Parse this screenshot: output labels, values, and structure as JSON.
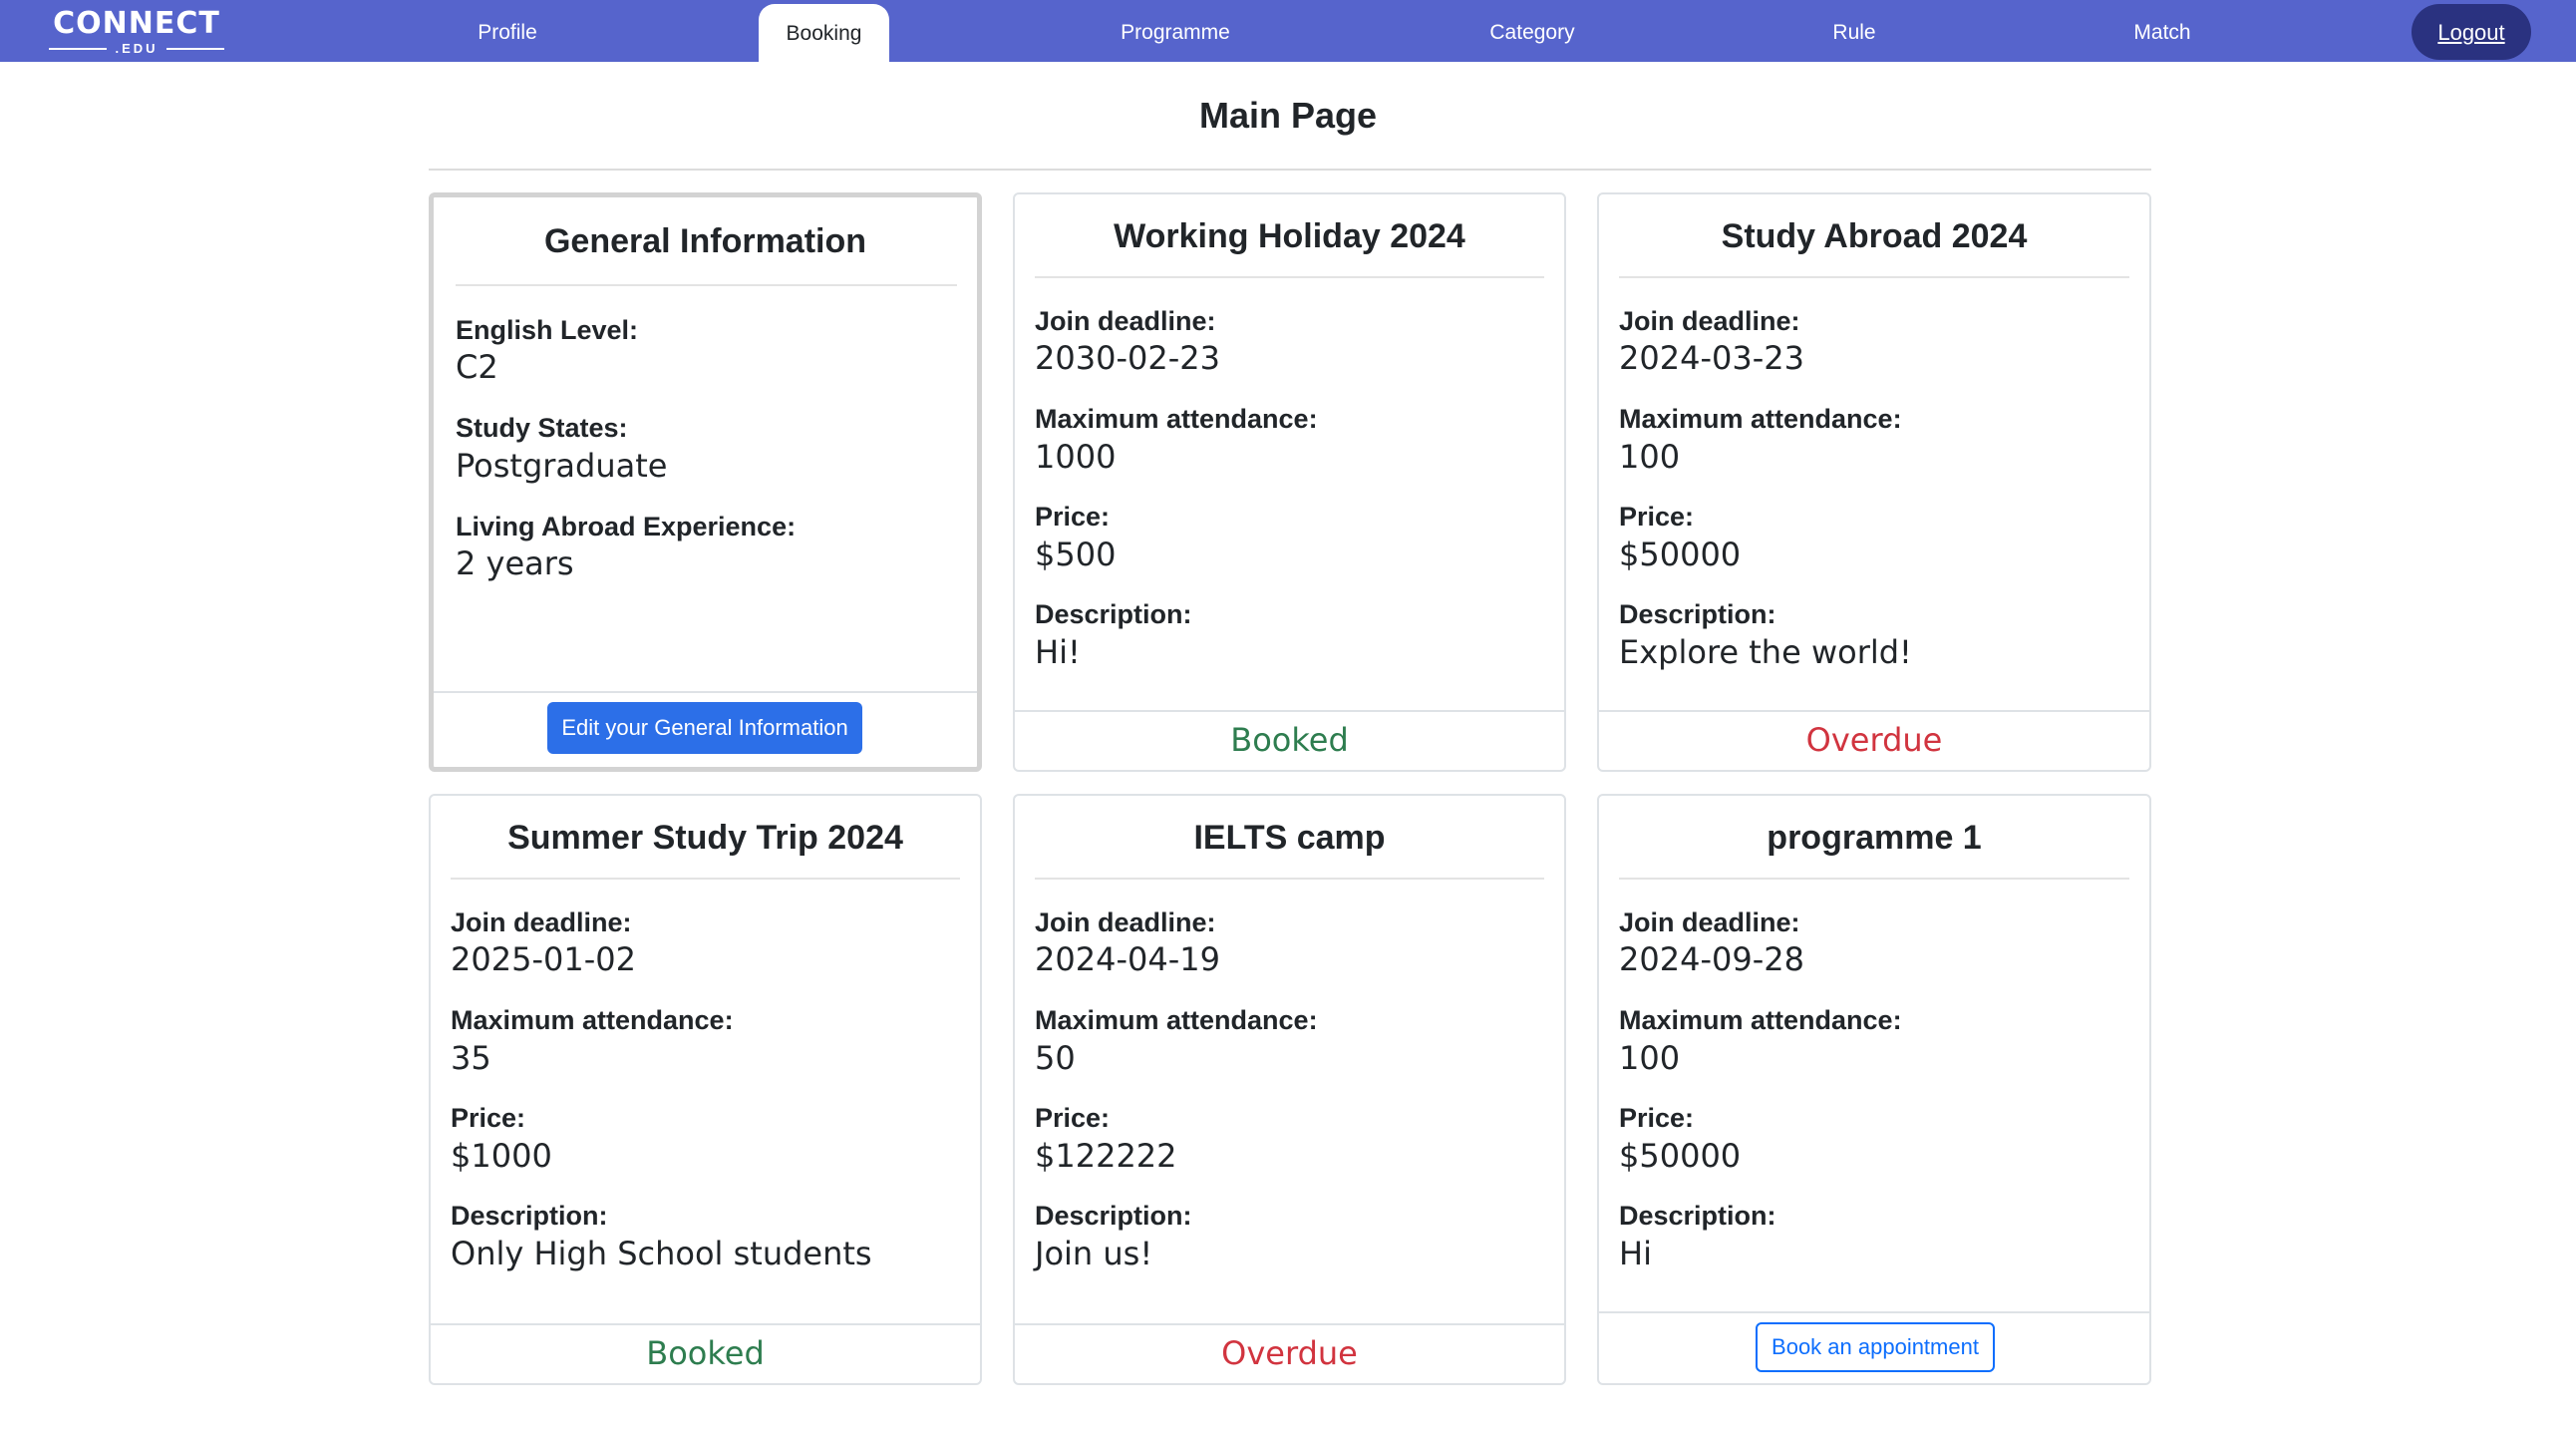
{
  "nav": {
    "logo_main": "CONNECT",
    "logo_sub": ".EDU",
    "items": [
      "Profile",
      "Booking",
      "Programme",
      "Category",
      "Rule",
      "Match"
    ],
    "active": "Booking",
    "logout": "Logout"
  },
  "page": {
    "title": "Main Page"
  },
  "general": {
    "title": "General Information",
    "english_label": "English Level:",
    "english_value": "C2",
    "study_label": "Study States:",
    "study_value": "Postgraduate",
    "abroad_label": "Living Abroad Experience:",
    "abroad_value": "2 years",
    "edit_button": "Edit your General Information"
  },
  "labels": {
    "deadline": "Join deadline:",
    "attendance": "Maximum attendance:",
    "price": "Price:",
    "description": "Description:"
  },
  "programmes": [
    {
      "title": "Working Holiday 2024",
      "deadline": "2030-02-23",
      "attendance": "1000",
      "price": "$500",
      "description": "Hi!",
      "status": "Booked"
    },
    {
      "title": "Study Abroad 2024",
      "deadline": "2024-03-23",
      "attendance": "100",
      "price": "$50000",
      "description": "Explore the world!",
      "status": "Overdue"
    },
    {
      "title": "Summer Study Trip 2024",
      "deadline": "2025-01-02",
      "attendance": "35",
      "price": "$1000",
      "description": "Only High School students",
      "status": "Booked"
    },
    {
      "title": "IELTS camp",
      "deadline": "2024-04-19",
      "attendance": "50",
      "price": "$122222",
      "description": "Join us!",
      "status": "Overdue"
    },
    {
      "title": "programme 1",
      "deadline": "2024-09-28",
      "attendance": "100",
      "price": "$50000",
      "description": "Hi",
      "status": "",
      "action": "Book an appointment"
    }
  ],
  "colors": {
    "nav": "#5664cc",
    "booked": "#2e7d4f",
    "overdue": "#d1343f",
    "primary": "#2c6fe8"
  }
}
